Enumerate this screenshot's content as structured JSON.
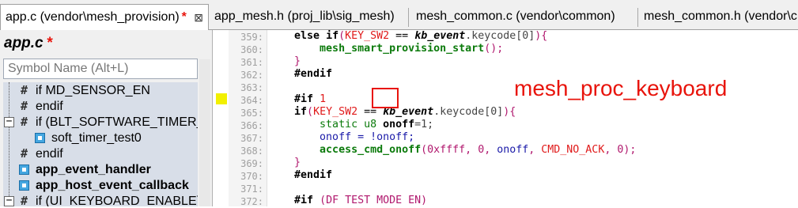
{
  "tabs": [
    {
      "label": "app.c (vendor\\mesh_provision)",
      "modified": "*",
      "close": "⊠"
    },
    {
      "label": "app_mesh.h (proj_lib\\sig_mesh)"
    },
    {
      "label": "mesh_common.c (vendor\\common)"
    },
    {
      "label": "mesh_common.h (vendor\\c"
    }
  ],
  "symbol_panel": {
    "title": "app.c",
    "modified": "*",
    "search_placeholder": "Symbol Name (Alt+L)",
    "items": [
      {
        "label": "if MD_SENSOR_EN",
        "icon": "hash-icon"
      },
      {
        "label": "endif",
        "icon": "hash-icon"
      },
      {
        "label": "if (BLT_SOFTWARE_TIMER_E",
        "icon": "hash-icon",
        "expander": "−"
      },
      {
        "label": "soft_timer_test0",
        "icon": "function-icon"
      },
      {
        "label": "endif",
        "icon": "hash-icon"
      },
      {
        "label": "app_event_handler",
        "icon": "function-icon",
        "bold": true
      },
      {
        "label": "app_host_event_callback",
        "icon": "function-icon",
        "bold": true
      },
      {
        "label": "if (UI_KEYBOARD_ENABLE)",
        "icon": "hash-icon",
        "expander": "−"
      }
    ]
  },
  "editor": {
    "line_numbers": [
      "359:",
      "360:",
      "361:",
      "362:",
      "363:",
      "364:",
      "365:",
      "366:",
      "367:",
      "368:",
      "369:",
      "370:",
      "371:",
      "372:"
    ],
    "tokens": {
      "else": "else",
      "if": "if",
      "key_sw2": "KEY_SW2",
      "eq": " == ",
      "kb_event": "kb_event",
      "keycode": ".keycode[0]",
      "open_paren": "(",
      "close_brace_paren": "){",
      "mesh_smart_provision_start": "mesh_smart_provision_start",
      "call_end": "();",
      "rbrace": "}",
      "endif": "#endif",
      "hash_if": "#if ",
      "one": "1",
      "static": "static",
      "u8": "u8",
      "onoff": "onoff",
      "eq1": "=1;",
      "onoff_assign": "onoff = !",
      "onoff_end": "onoff;",
      "access_cmd_onoff": "access_cmd_onoff",
      "args_a": "(0xffff, 0, ",
      "args_b": ", ",
      "cmd_no_ack": "CMD_NO_ACK",
      "args_c": ", 0);",
      "hash_if2": "#if ",
      "df_test": "(DF TEST MODE EN)"
    }
  },
  "annotation": "mesh_proc_keyboard",
  "colors": {
    "annotation": "#e8140c",
    "bookmark": "#f2f000"
  }
}
